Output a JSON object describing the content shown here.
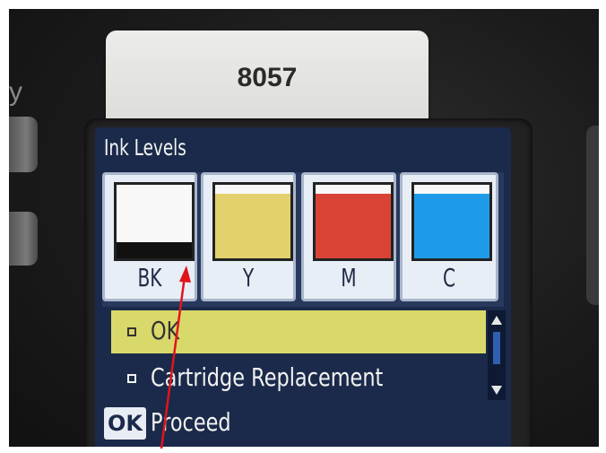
{
  "sticker": {
    "text": "8057"
  },
  "bezel_edge_text": "y",
  "screen": {
    "title": "Ink Levels",
    "inks": [
      {
        "label": "BK",
        "level": 0.22,
        "color": "#111111"
      },
      {
        "label": "Y",
        "level": 0.88,
        "color": "#e2d16c"
      },
      {
        "label": "M",
        "level": 0.88,
        "color": "#d94335"
      },
      {
        "label": "C",
        "level": 0.88,
        "color": "#1e9be8"
      }
    ],
    "menu": {
      "items": [
        {
          "label": "OK",
          "selected": true
        },
        {
          "label": "Cartridge Replacement",
          "selected": false
        }
      ]
    },
    "footer": {
      "key": "OK",
      "label": "Proceed"
    }
  },
  "annotation": {
    "type": "red-arrow",
    "color": "#e0151b",
    "points_to": "BK"
  }
}
